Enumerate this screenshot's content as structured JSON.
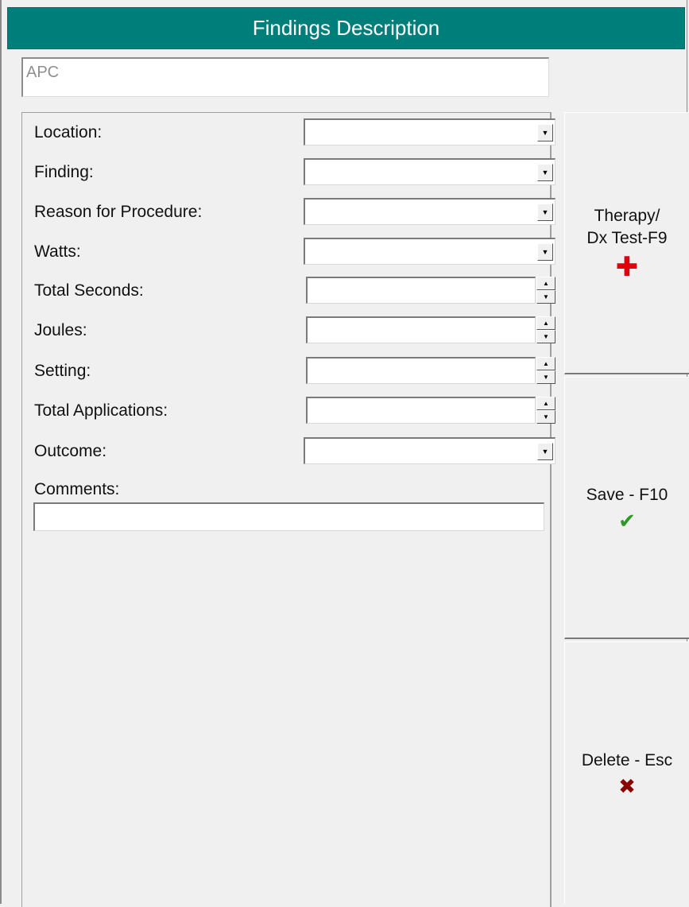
{
  "window": {
    "title": "Findings Description"
  },
  "description": {
    "value": "APC"
  },
  "fields": [
    {
      "label": "Location:",
      "type": "combo",
      "value": ""
    },
    {
      "label": "Finding:",
      "type": "combo",
      "value": ""
    },
    {
      "label": "Reason for Procedure:",
      "type": "combo",
      "value": ""
    },
    {
      "label": "Watts:",
      "type": "combo",
      "value": ""
    },
    {
      "label": "Total Seconds:",
      "type": "spin",
      "value": ""
    },
    {
      "label": "Joules:",
      "type": "spin",
      "value": ""
    },
    {
      "label": "Setting:",
      "type": "spin",
      "value": ""
    },
    {
      "label": "Total Applications:",
      "type": "spin",
      "value": ""
    },
    {
      "label": "Outcome:",
      "type": "combo",
      "value": ""
    }
  ],
  "comments": {
    "label": "Comments:",
    "value": ""
  },
  "buttons": {
    "therapy": {
      "line1": "Therapy/",
      "line2": "Dx Test-F9",
      "icon": "red-plus-icon"
    },
    "save": {
      "label": "Save - F10",
      "icon": "green-check-icon"
    },
    "delete": {
      "label": "Delete - Esc",
      "icon": "red-x-icon"
    }
  },
  "glyphs": {
    "dropdown": "▼",
    "spin_up": "▲",
    "spin_down": "▼",
    "plus": "✚",
    "check": "✔",
    "x": "✖"
  },
  "colors": {
    "titlebar": "#007e79",
    "plus": "#e0000b",
    "check": "#2f9a25",
    "x": "#8b0000"
  }
}
